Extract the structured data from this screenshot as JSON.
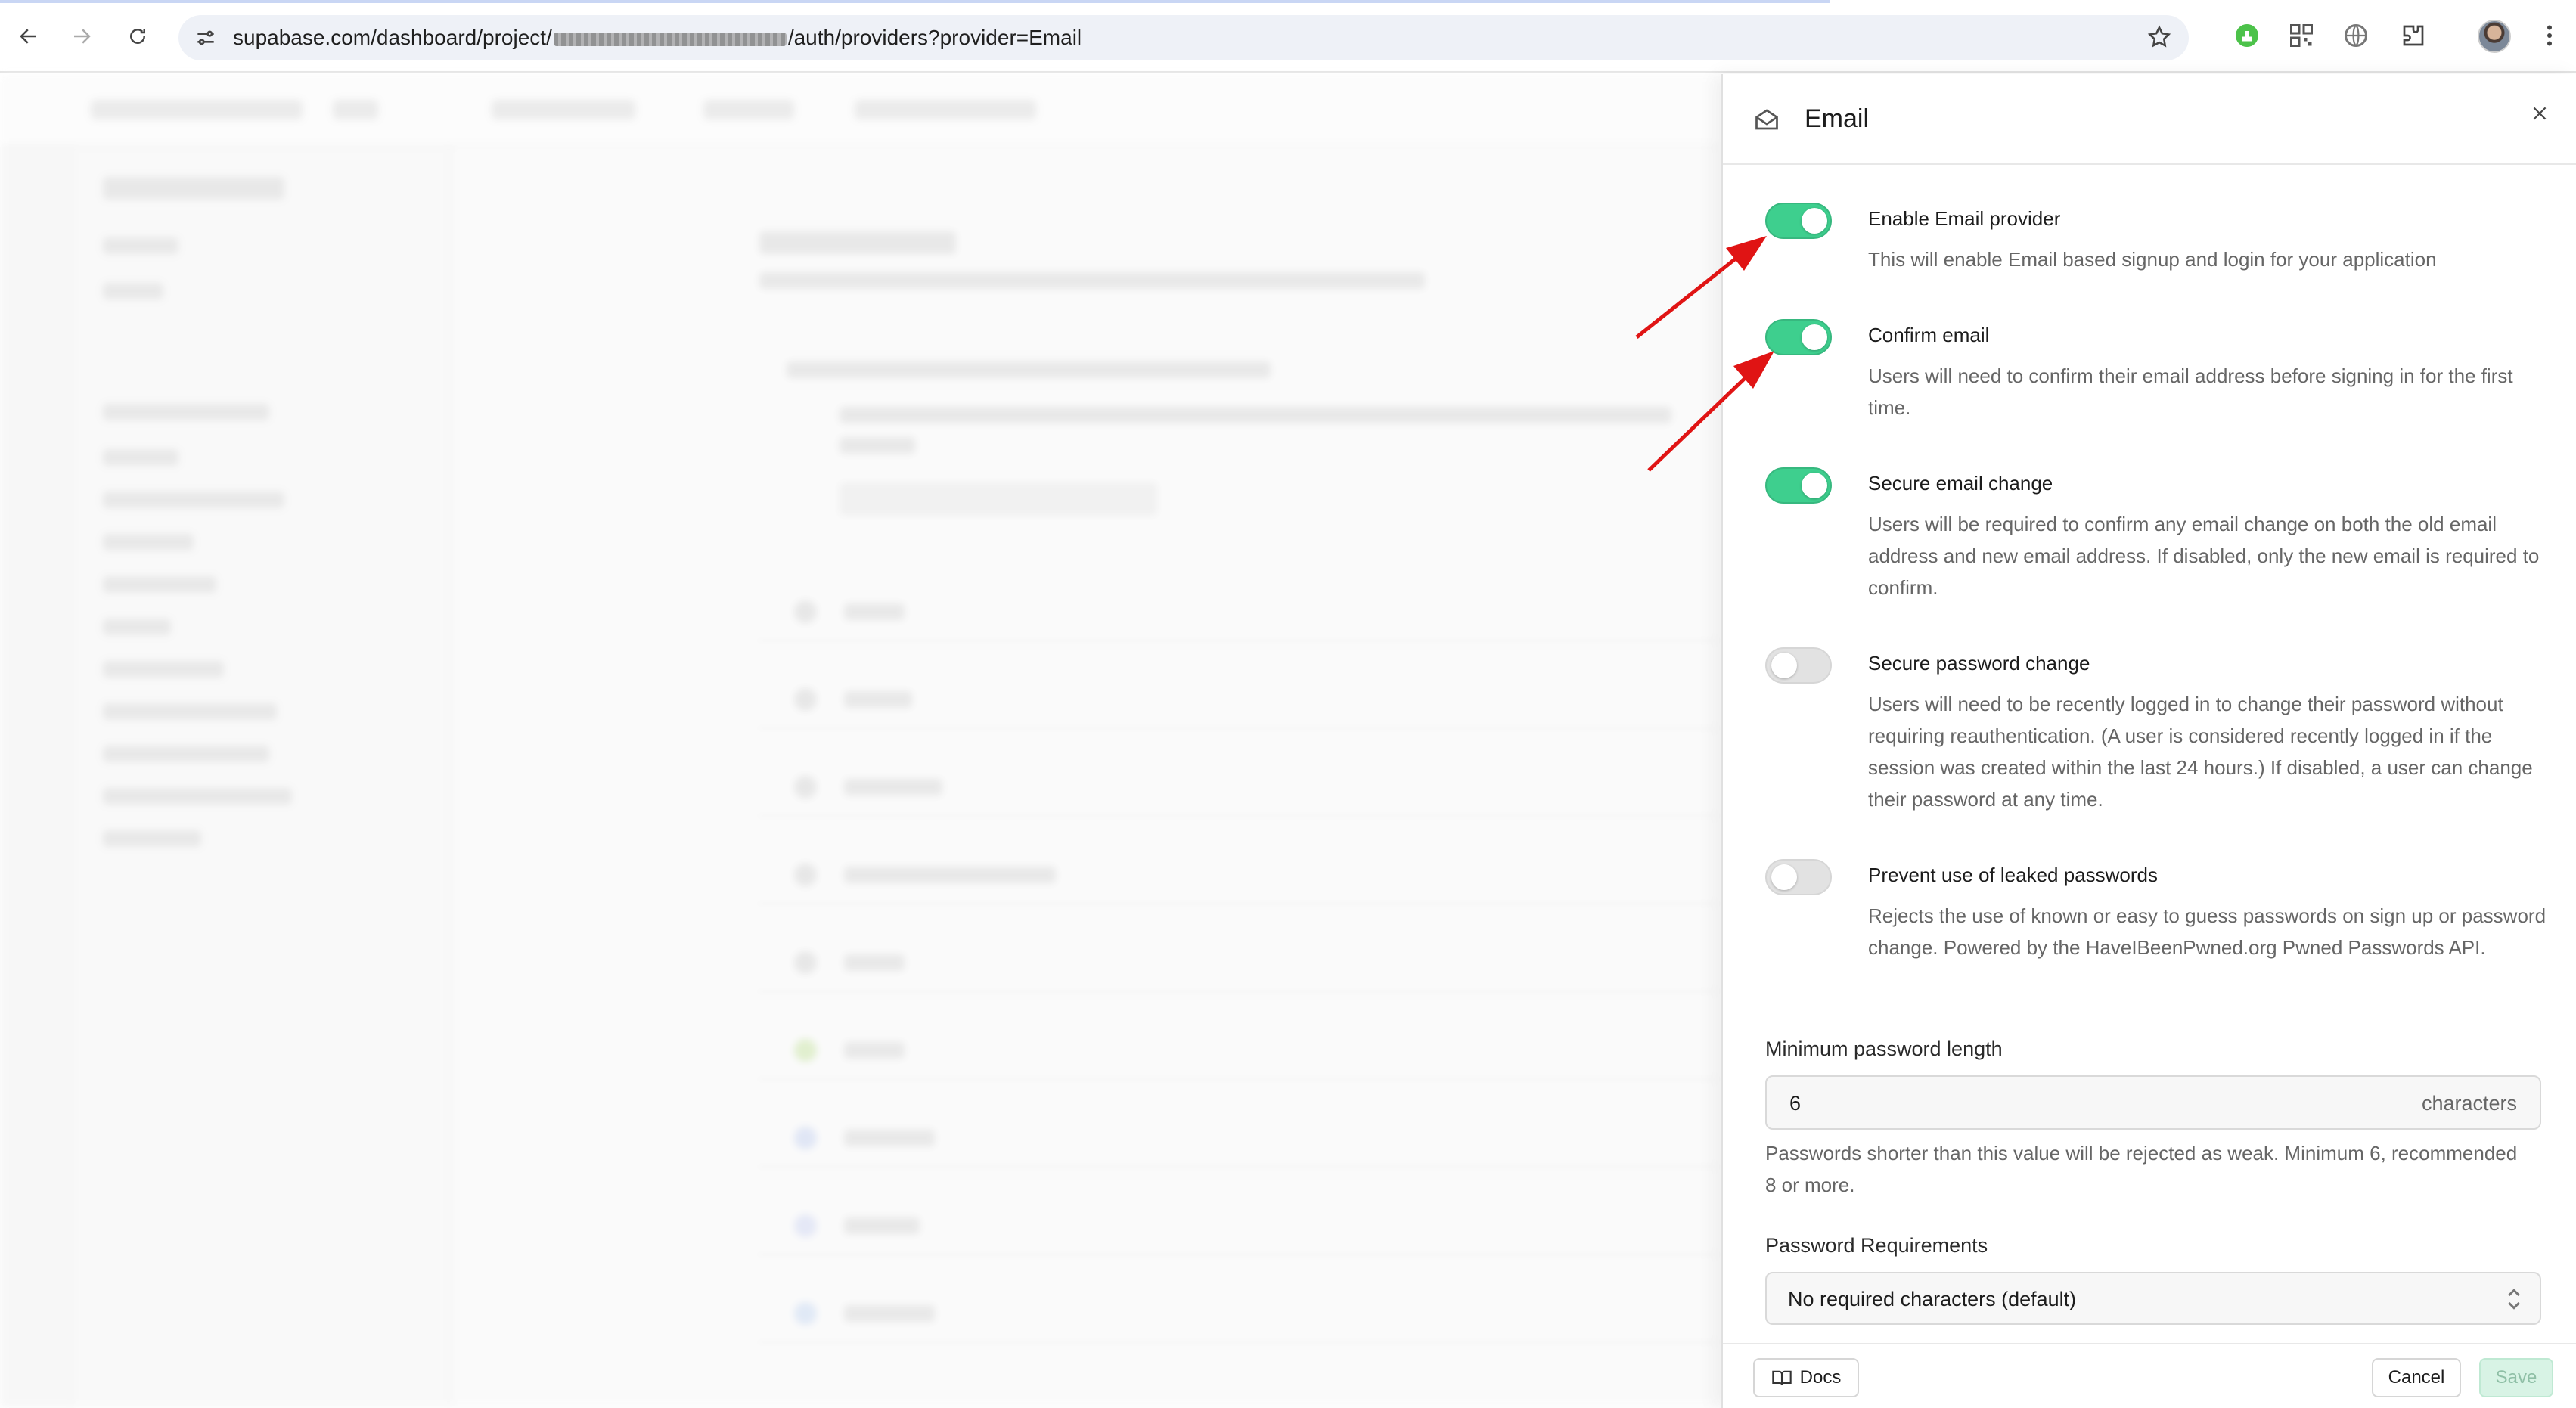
{
  "browser": {
    "url_prefix": "supabase.com/dashboard/project/",
    "url_suffix": "/auth/providers?provider=Email"
  },
  "panel": {
    "title": "Email",
    "settings": [
      {
        "label": "Enable Email provider",
        "description": "This will enable Email based signup and login for your application",
        "enabled": true
      },
      {
        "label": "Confirm email",
        "description": "Users will need to confirm their email address before signing in for the first time.",
        "enabled": true
      },
      {
        "label": "Secure email change",
        "description": "Users will be required to confirm any email change on both the old email address and new email address. If disabled, only the new email is required to confirm.",
        "enabled": true
      },
      {
        "label": "Secure password change",
        "description": "Users will need to be recently logged in to change their password without requiring reauthentication. (A user is considered recently logged in if the session was created within the last 24 hours.) If disabled, a user can change their password at any time.",
        "enabled": false
      },
      {
        "label": "Prevent use of leaked passwords",
        "description": "Rejects the use of known or easy to guess passwords on sign up or password change. Powered by the HaveIBeenPwned.org Pwned Passwords API.",
        "enabled": false
      }
    ],
    "min_password": {
      "label": "Minimum password length",
      "value": "6",
      "suffix": "characters",
      "helper": "Passwords shorter than this value will be rejected as weak. Minimum 6, recommended 8 or more."
    },
    "password_requirements": {
      "label": "Password Requirements",
      "selected": "No required characters (default)"
    },
    "footer": {
      "docs": "Docs",
      "cancel": "Cancel",
      "save": "Save"
    }
  },
  "colors": {
    "toggle_on": "#3ecf8e",
    "toggle_off": "#e2e2e2",
    "annotation_arrow": "#e01414"
  }
}
